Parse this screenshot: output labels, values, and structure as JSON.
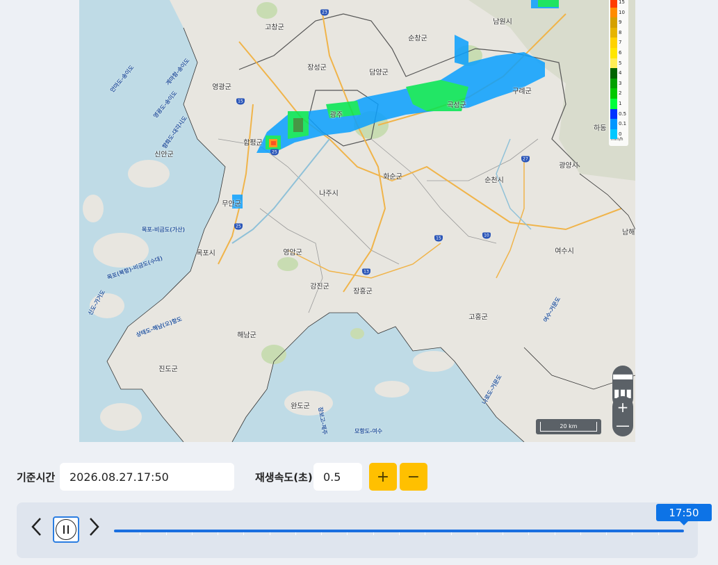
{
  "map": {
    "places": [
      {
        "name": "고창군"
      },
      {
        "name": "순창군"
      },
      {
        "name": "남원시"
      },
      {
        "name": "장성군"
      },
      {
        "name": "담양군"
      },
      {
        "name": "영광군"
      },
      {
        "name": "광주"
      },
      {
        "name": "곡성군"
      },
      {
        "name": "구례군"
      },
      {
        "name": "함평군"
      },
      {
        "name": "화순군"
      },
      {
        "name": "순천시"
      },
      {
        "name": "광양시"
      },
      {
        "name": "하동"
      },
      {
        "name": "신안군"
      },
      {
        "name": "나주시"
      },
      {
        "name": "무안군"
      },
      {
        "name": "목포시"
      },
      {
        "name": "영암군"
      },
      {
        "name": "남해"
      },
      {
        "name": "여수시"
      },
      {
        "name": "강진군"
      },
      {
        "name": "장흥군"
      },
      {
        "name": "고흥군"
      },
      {
        "name": "해남군"
      },
      {
        "name": "진도군"
      },
      {
        "name": "완도군"
      }
    ],
    "sea_labels": [
      "안마도-송이도",
      "계마항-송이도",
      "영광도-송이도",
      "향화도-대각시도",
      "목포-비금도(가산)",
      "목포(북항)-비금도(수대)",
      "상태도-해남(오)항도",
      "신도-가거도",
      "여수-거문도",
      "나로도-거문도",
      "장보고-제주",
      "모항도-여수"
    ],
    "highway_numbers": [
      "23",
      "15",
      "25",
      "25",
      "27",
      "15",
      "10",
      "13",
      "15"
    ],
    "legend": {
      "levels": [
        "15",
        "10",
        "9",
        "8",
        "7",
        "6",
        "5",
        "4",
        "3",
        "2",
        "1",
        "0.5",
        "0.1",
        "0"
      ],
      "colors": [
        "#ff3c00",
        "#ff8c00",
        "#d4a000",
        "#e6b400",
        "#ffd200",
        "#ffe600",
        "#ffee55",
        "#006400",
        "#00a000",
        "#00c800",
        "#00ff3c",
        "#0032ff",
        "#0096ff",
        "#00c8ff"
      ],
      "unit": "mm/h"
    },
    "scale_label": "20 km",
    "tools": {
      "zoom_in": "+",
      "zoom_out": "—"
    }
  },
  "controls": {
    "base_time_label": "기준시간",
    "base_time_value": "2026.08.27.17:50",
    "speed_label": "재생속도(초)",
    "speed_value": "0.5",
    "plus": "+",
    "minus": "−"
  },
  "timeline": {
    "current_time": "17:50",
    "progress": 1.0,
    "tick_count": 22
  },
  "colors": {
    "accent": "#0d73e6",
    "button_yellow": "#ffc000",
    "panel": "#dfe5ee"
  }
}
